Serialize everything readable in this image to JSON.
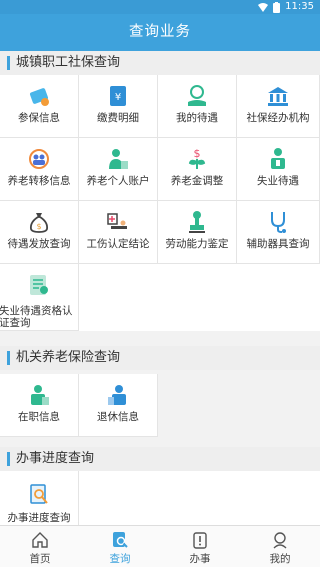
{
  "status": {
    "time": "11:35"
  },
  "header": {
    "title": "查询业务"
  },
  "sections": [
    {
      "title": "城镇职工社保查询"
    },
    {
      "title": "机关养老保险查询"
    },
    {
      "title": "办事进度查询"
    }
  ],
  "urban": [
    {
      "label": "参保信息",
      "icon": "id-card-icon"
    },
    {
      "label": "缴费明细",
      "icon": "payment-document-icon"
    },
    {
      "label": "我的待遇",
      "icon": "hand-coin-icon"
    },
    {
      "label": "社保经办机构",
      "icon": "bank-icon"
    },
    {
      "label": "养老转移信息",
      "icon": "transfer-people-icon"
    },
    {
      "label": "养老个人账户",
      "icon": "personal-account-icon"
    },
    {
      "label": "养老金调整",
      "icon": "money-plant-icon"
    },
    {
      "label": "失业待遇",
      "icon": "unemployed-person-icon"
    },
    {
      "label": "待遇发放查询",
      "icon": "money-bag-icon"
    },
    {
      "label": "工伤认定结论",
      "icon": "injury-bed-icon"
    },
    {
      "label": "劳动能力鉴定",
      "icon": "stamp-icon"
    },
    {
      "label": "辅助器具查询",
      "icon": "stethoscope-icon"
    },
    {
      "label": "失业待遇资格认证查询",
      "icon": "certificate-icon"
    }
  ],
  "gov": [
    {
      "label": "在职信息",
      "icon": "employed-person-icon"
    },
    {
      "label": "退休信息",
      "icon": "retired-person-icon"
    }
  ],
  "progress": [
    {
      "label": "办事进度查询",
      "icon": "progress-search-icon"
    }
  ],
  "tabs": [
    {
      "label": "首页",
      "icon": "home-icon"
    },
    {
      "label": "查询",
      "icon": "search-icon"
    },
    {
      "label": "办事",
      "icon": "clipboard-icon"
    },
    {
      "label": "我的",
      "icon": "user-icon"
    }
  ],
  "colors": {
    "primary": "#3ea2dc",
    "statusbar": "#3a9bd5"
  }
}
